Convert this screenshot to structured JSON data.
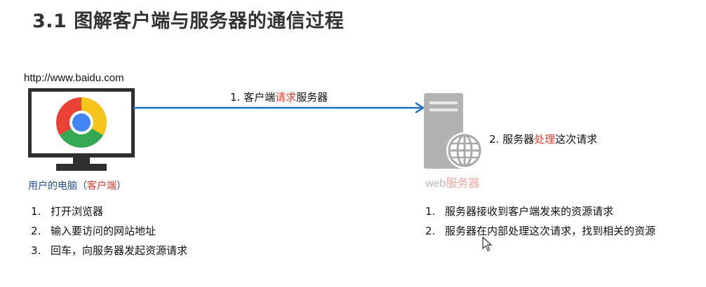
{
  "title": "3.1 图解客户端与服务器的通信过程",
  "client": {
    "url": "http://www.baidu.com",
    "caption_prefix": "用户的电脑（",
    "caption_highlight": "客户端",
    "caption_suffix": "）",
    "steps": [
      {
        "num": "1.",
        "text": "打开浏览器"
      },
      {
        "num": "2.",
        "text": "输入要访问的网站地址"
      },
      {
        "num": "3.",
        "text": "回车，向服务器发起资源请求"
      }
    ]
  },
  "request": {
    "prefix": "1. 客户端",
    "highlight": "请求",
    "suffix": "服务器"
  },
  "server": {
    "caption_en": "web",
    "caption_cn": "服务器",
    "process_prefix": "2. 服务器",
    "process_highlight": "处理",
    "process_suffix": "这次请求",
    "steps": [
      {
        "num": "1.",
        "text": "服务器接收到客户端发来的资源请求"
      },
      {
        "num": "2.",
        "text": "服务器在内部处理这次请求，找到相关的资源"
      }
    ]
  },
  "colors": {
    "arrow": "#1f6fc0",
    "highlight": "#e53b2c",
    "caption_blue": "#1f4e9c",
    "server_gray": "#b3b3b3"
  },
  "icons": [
    "monitor-icon",
    "chrome-logo-icon",
    "server-icon",
    "globe-icon",
    "mouse-cursor-icon"
  ]
}
